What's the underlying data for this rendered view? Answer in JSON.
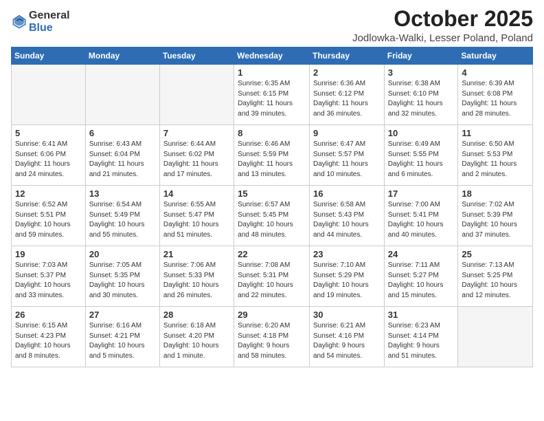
{
  "logo": {
    "general": "General",
    "blue": "Blue"
  },
  "header": {
    "month": "October 2025",
    "location": "Jodlowka-Walki, Lesser Poland, Poland"
  },
  "weekdays": [
    "Sunday",
    "Monday",
    "Tuesday",
    "Wednesday",
    "Thursday",
    "Friday",
    "Saturday"
  ],
  "weeks": [
    [
      {
        "day": "",
        "info": ""
      },
      {
        "day": "",
        "info": ""
      },
      {
        "day": "",
        "info": ""
      },
      {
        "day": "1",
        "info": "Sunrise: 6:35 AM\nSunset: 6:15 PM\nDaylight: 11 hours\nand 39 minutes."
      },
      {
        "day": "2",
        "info": "Sunrise: 6:36 AM\nSunset: 6:12 PM\nDaylight: 11 hours\nand 36 minutes."
      },
      {
        "day": "3",
        "info": "Sunrise: 6:38 AM\nSunset: 6:10 PM\nDaylight: 11 hours\nand 32 minutes."
      },
      {
        "day": "4",
        "info": "Sunrise: 6:39 AM\nSunset: 6:08 PM\nDaylight: 11 hours\nand 28 minutes."
      }
    ],
    [
      {
        "day": "5",
        "info": "Sunrise: 6:41 AM\nSunset: 6:06 PM\nDaylight: 11 hours\nand 24 minutes."
      },
      {
        "day": "6",
        "info": "Sunrise: 6:43 AM\nSunset: 6:04 PM\nDaylight: 11 hours\nand 21 minutes."
      },
      {
        "day": "7",
        "info": "Sunrise: 6:44 AM\nSunset: 6:02 PM\nDaylight: 11 hours\nand 17 minutes."
      },
      {
        "day": "8",
        "info": "Sunrise: 6:46 AM\nSunset: 5:59 PM\nDaylight: 11 hours\nand 13 minutes."
      },
      {
        "day": "9",
        "info": "Sunrise: 6:47 AM\nSunset: 5:57 PM\nDaylight: 11 hours\nand 10 minutes."
      },
      {
        "day": "10",
        "info": "Sunrise: 6:49 AM\nSunset: 5:55 PM\nDaylight: 11 hours\nand 6 minutes."
      },
      {
        "day": "11",
        "info": "Sunrise: 6:50 AM\nSunset: 5:53 PM\nDaylight: 11 hours\nand 2 minutes."
      }
    ],
    [
      {
        "day": "12",
        "info": "Sunrise: 6:52 AM\nSunset: 5:51 PM\nDaylight: 10 hours\nand 59 minutes."
      },
      {
        "day": "13",
        "info": "Sunrise: 6:54 AM\nSunset: 5:49 PM\nDaylight: 10 hours\nand 55 minutes."
      },
      {
        "day": "14",
        "info": "Sunrise: 6:55 AM\nSunset: 5:47 PM\nDaylight: 10 hours\nand 51 minutes."
      },
      {
        "day": "15",
        "info": "Sunrise: 6:57 AM\nSunset: 5:45 PM\nDaylight: 10 hours\nand 48 minutes."
      },
      {
        "day": "16",
        "info": "Sunrise: 6:58 AM\nSunset: 5:43 PM\nDaylight: 10 hours\nand 44 minutes."
      },
      {
        "day": "17",
        "info": "Sunrise: 7:00 AM\nSunset: 5:41 PM\nDaylight: 10 hours\nand 40 minutes."
      },
      {
        "day": "18",
        "info": "Sunrise: 7:02 AM\nSunset: 5:39 PM\nDaylight: 10 hours\nand 37 minutes."
      }
    ],
    [
      {
        "day": "19",
        "info": "Sunrise: 7:03 AM\nSunset: 5:37 PM\nDaylight: 10 hours\nand 33 minutes."
      },
      {
        "day": "20",
        "info": "Sunrise: 7:05 AM\nSunset: 5:35 PM\nDaylight: 10 hours\nand 30 minutes."
      },
      {
        "day": "21",
        "info": "Sunrise: 7:06 AM\nSunset: 5:33 PM\nDaylight: 10 hours\nand 26 minutes."
      },
      {
        "day": "22",
        "info": "Sunrise: 7:08 AM\nSunset: 5:31 PM\nDaylight: 10 hours\nand 22 minutes."
      },
      {
        "day": "23",
        "info": "Sunrise: 7:10 AM\nSunset: 5:29 PM\nDaylight: 10 hours\nand 19 minutes."
      },
      {
        "day": "24",
        "info": "Sunrise: 7:11 AM\nSunset: 5:27 PM\nDaylight: 10 hours\nand 15 minutes."
      },
      {
        "day": "25",
        "info": "Sunrise: 7:13 AM\nSunset: 5:25 PM\nDaylight: 10 hours\nand 12 minutes."
      }
    ],
    [
      {
        "day": "26",
        "info": "Sunrise: 6:15 AM\nSunset: 4:23 PM\nDaylight: 10 hours\nand 8 minutes."
      },
      {
        "day": "27",
        "info": "Sunrise: 6:16 AM\nSunset: 4:21 PM\nDaylight: 10 hours\nand 5 minutes."
      },
      {
        "day": "28",
        "info": "Sunrise: 6:18 AM\nSunset: 4:20 PM\nDaylight: 10 hours\nand 1 minute."
      },
      {
        "day": "29",
        "info": "Sunrise: 6:20 AM\nSunset: 4:18 PM\nDaylight: 9 hours\nand 58 minutes."
      },
      {
        "day": "30",
        "info": "Sunrise: 6:21 AM\nSunset: 4:16 PM\nDaylight: 9 hours\nand 54 minutes."
      },
      {
        "day": "31",
        "info": "Sunrise: 6:23 AM\nSunset: 4:14 PM\nDaylight: 9 hours\nand 51 minutes."
      },
      {
        "day": "",
        "info": ""
      }
    ]
  ]
}
